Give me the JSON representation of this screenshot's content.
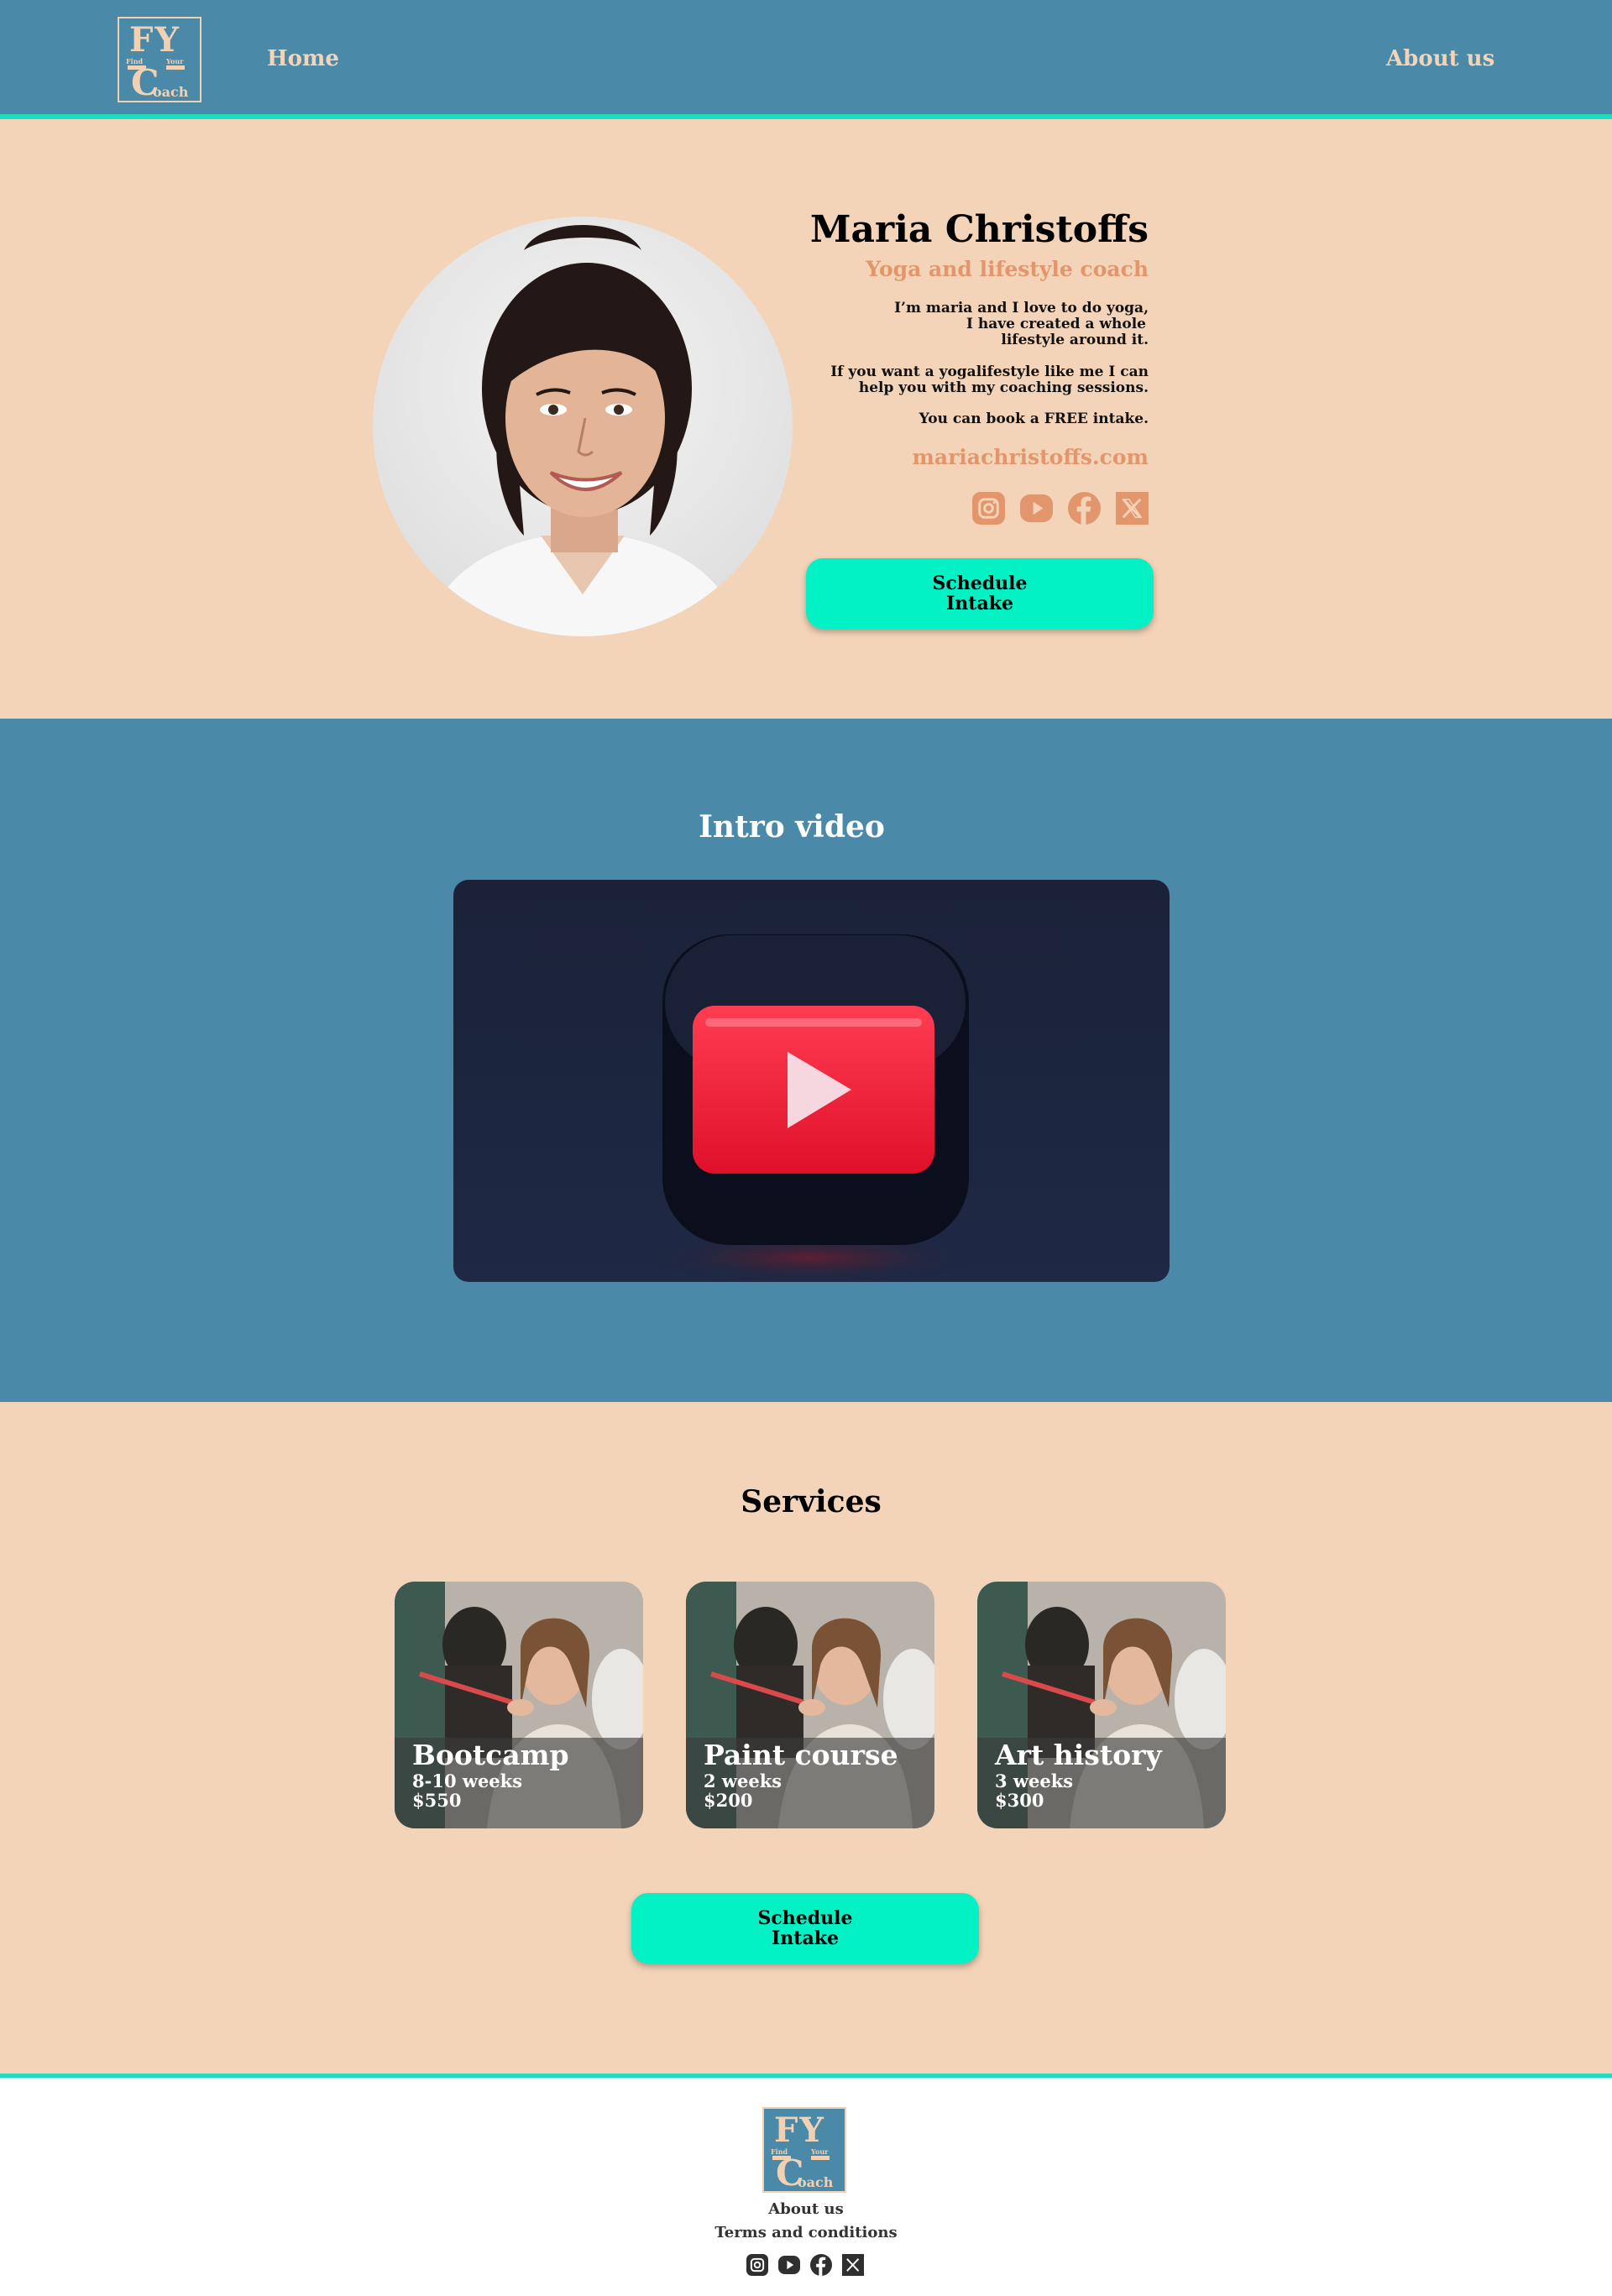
{
  "header": {
    "logo": {
      "top": "FY",
      "find": "Find",
      "your": "Your",
      "c": "C",
      "oach": "oach"
    },
    "nav": {
      "home": "Home",
      "about": "About us"
    }
  },
  "hero": {
    "name": "Maria Christoffs",
    "role": "Yoga and lifestyle coach",
    "bio1": [
      "I’m maria and I love to do yoga,",
      "I have created a whole",
      "lifestyle around it."
    ],
    "bio2": [
      "If you want a yogalifestyle like me I can",
      "help you with my coaching sessions."
    ],
    "bio3": "You can book a FREE intake.",
    "website": "mariachristoffs.com",
    "social_icons": [
      "instagram-icon",
      "youtube-icon",
      "facebook-icon",
      "x-icon"
    ],
    "cta": "Schedule\nIntake"
  },
  "video": {
    "title": "Intro video"
  },
  "services": {
    "title": "Services",
    "items": [
      {
        "title": "Bootcamp",
        "duration": "8-10 weeks",
        "price": "$550"
      },
      {
        "title": "Paint course",
        "duration": "2 weeks",
        "price": "$200"
      },
      {
        "title": "Art history",
        "duration": "3 weeks",
        "price": "$300"
      }
    ],
    "cta": "Schedule\nIntake"
  },
  "footer": {
    "about": "About us",
    "terms": "Terms and conditions",
    "social_icons": [
      "instagram-icon",
      "youtube-icon",
      "facebook-icon",
      "x-icon"
    ]
  },
  "colors": {
    "header_bg": "#4a8aa8",
    "peach": "#f3d4b9",
    "accent_teal": "#1fdcc0",
    "button": "#02f2c6",
    "orange_text": "#e3966c"
  }
}
